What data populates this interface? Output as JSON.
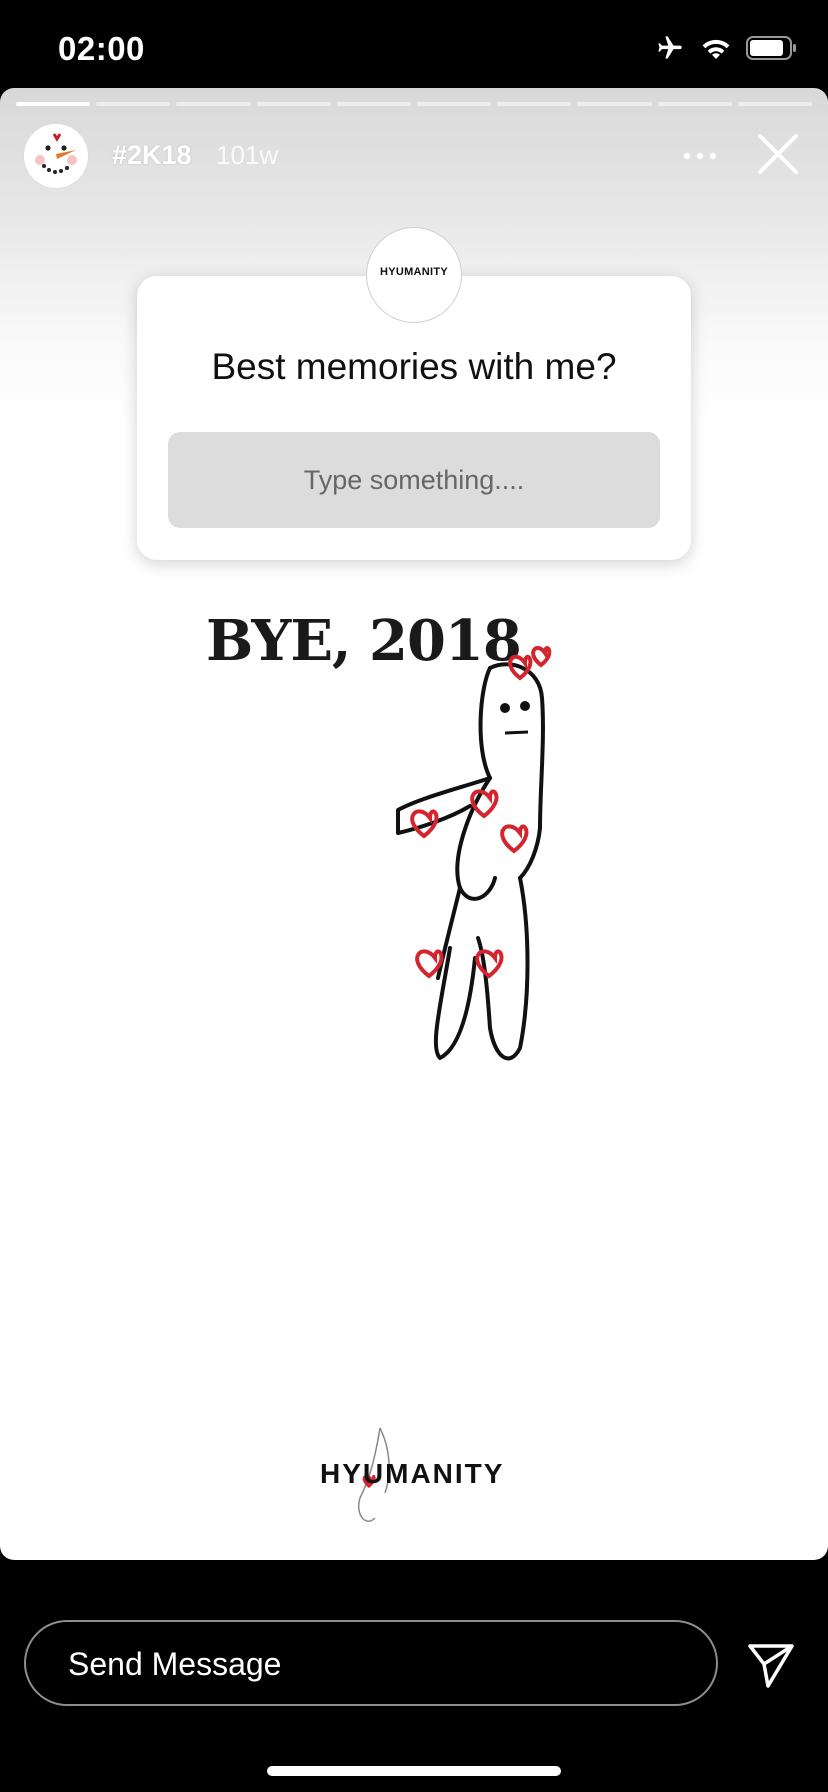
{
  "status_bar": {
    "time": "02:00",
    "icons": [
      "airplane-icon",
      "wifi-icon",
      "battery-icon"
    ]
  },
  "story": {
    "segments": 10,
    "active_segment": 0,
    "title": "#2K18",
    "age": "101w",
    "more_icon": "more-horizontal-icon",
    "close_icon": "close-icon"
  },
  "question_sticker": {
    "logo_text": "HYUMANITY",
    "question": "Best memories with me?",
    "input_placeholder": "Type something...."
  },
  "content": {
    "headline": "BYE, 2018",
    "brand": "HYUMANITY"
  },
  "footer": {
    "message_placeholder": "Send Message",
    "send_icon": "send-icon"
  },
  "colors": {
    "heart_red": "#d4252f",
    "background": "#000000"
  }
}
